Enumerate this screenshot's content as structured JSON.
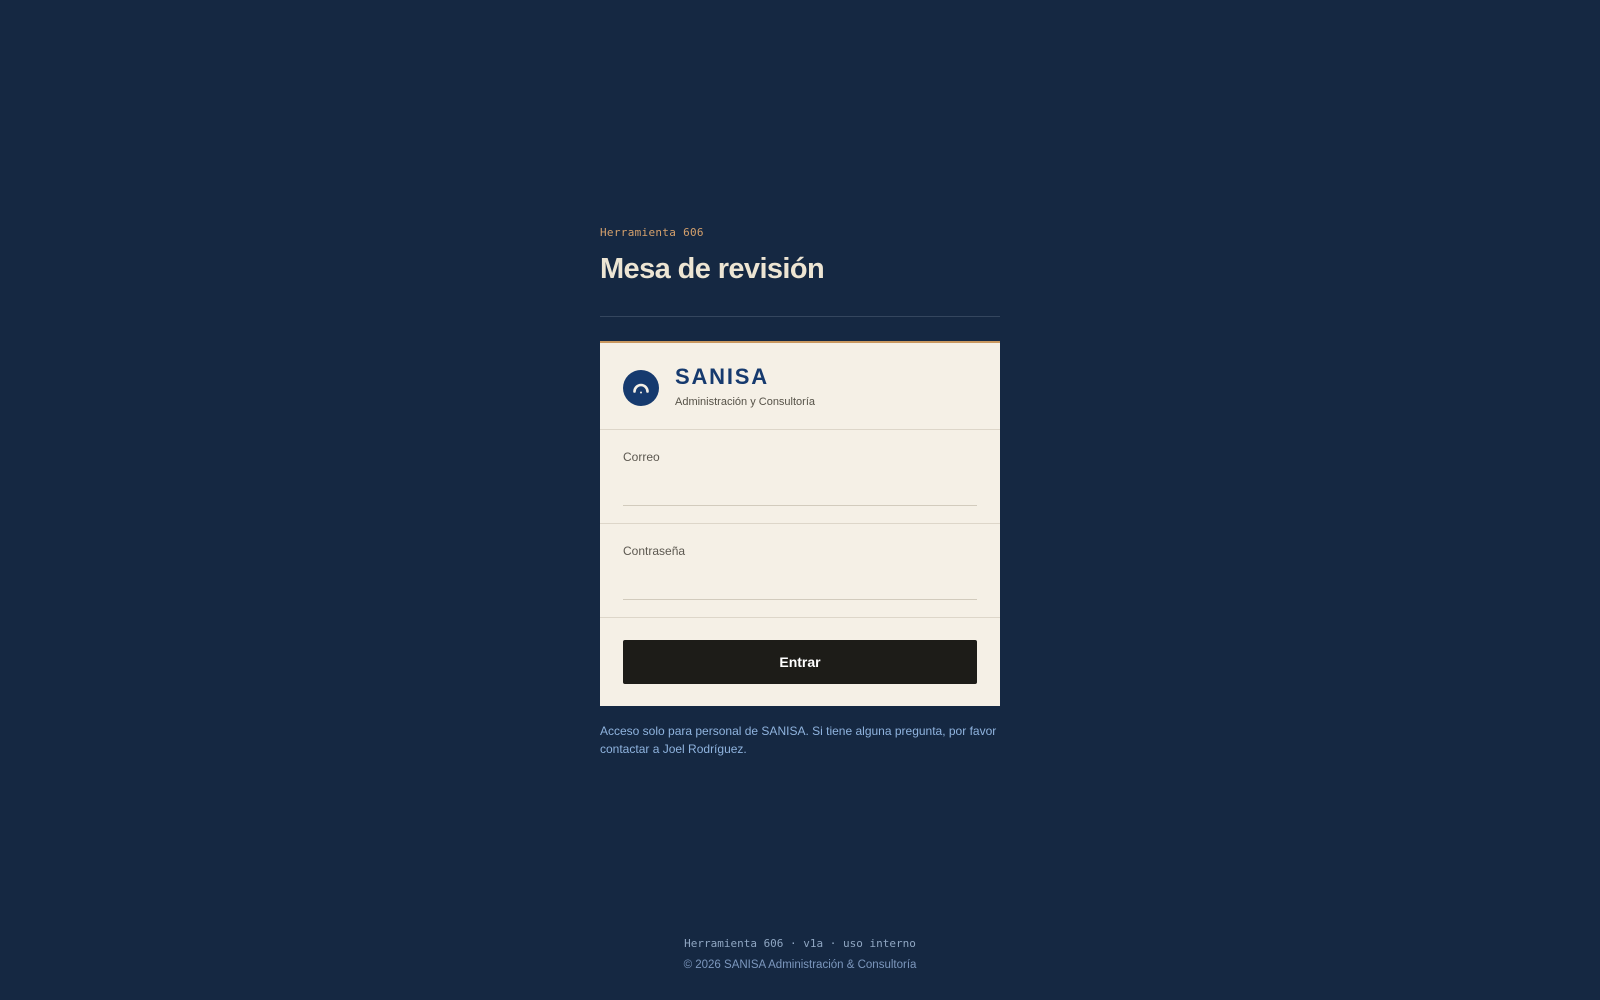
{
  "header": {
    "eyebrow": "Herramienta 606",
    "title": "Mesa de revisión"
  },
  "brand": {
    "logo_icon": "shield-arc-icon",
    "name": "SANISA",
    "subtitle": "Administración y Consultoría"
  },
  "form": {
    "email_label": "Correo",
    "email_value": "",
    "password_label": "Contraseña",
    "password_value": "",
    "submit_label": "Entrar"
  },
  "note": "Acceso solo para personal de SANISA. Si tiene alguna pregunta, por favor contactar a Joel Rodríguez.",
  "footer": {
    "meta": "Herramienta 606 · v1a · uso interno",
    "copyright": "© 2026 SANISA Administración & Consultoría"
  },
  "colors": {
    "background": "#152842",
    "card": "#f5f0e6",
    "accent": "#c9985f",
    "brand": "#163a6e",
    "button": "#1d1c18",
    "note": "#8fb3de"
  }
}
